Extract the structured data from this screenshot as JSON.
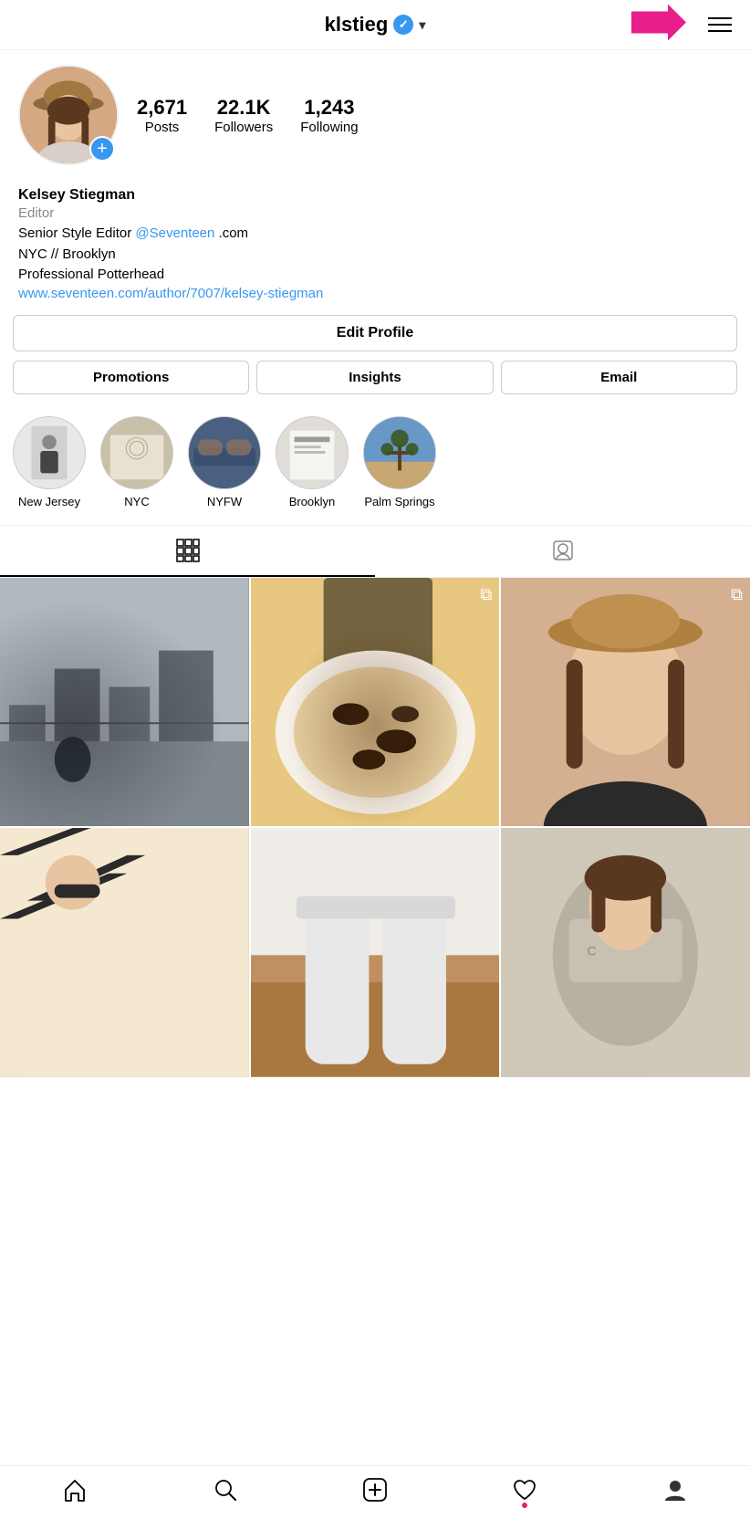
{
  "header": {
    "username": "klstieg",
    "dropdown_label": "▾",
    "hamburger_aria": "Menu"
  },
  "profile": {
    "stats": {
      "posts_count": "2,671",
      "posts_label": "Posts",
      "followers_count": "22.1K",
      "followers_label": "Followers",
      "following_count": "1,243",
      "following_label": "Following"
    },
    "bio": {
      "name": "Kelsey Stiegman",
      "title": "Editor",
      "line1_prefix": "Senior Style Editor ",
      "line1_mention": "@Seventeen",
      "line1_suffix": " .com",
      "line2": "NYC // Brooklyn",
      "line3": "Professional Potterhead",
      "link": "www.seventeen.com/author/7007/kelsey-stiegman"
    }
  },
  "buttons": {
    "edit_profile": "Edit Profile",
    "promotions": "Promotions",
    "insights": "Insights",
    "email": "Email"
  },
  "highlights": [
    {
      "label": "New Jersey",
      "style": "nj"
    },
    {
      "label": "NYC",
      "style": "nyc"
    },
    {
      "label": "NYFW",
      "style": "nyfw"
    },
    {
      "label": "Brooklyn",
      "style": "brooklyn"
    },
    {
      "label": "Palm Springs",
      "style": "ps"
    }
  ],
  "tabs": {
    "grid_tab_aria": "Posts grid view",
    "tagged_tab_aria": "Tagged posts"
  },
  "grid_items": [
    {
      "id": 1,
      "style": "gi-1",
      "has_multi": false
    },
    {
      "id": 2,
      "style": "gi-2",
      "has_multi": true
    },
    {
      "id": 3,
      "style": "gi-3",
      "has_multi": true
    },
    {
      "id": 4,
      "style": "gi-4",
      "has_multi": false
    },
    {
      "id": 5,
      "style": "gi-5",
      "has_multi": false
    },
    {
      "id": 6,
      "style": "gi-6",
      "has_multi": false
    }
  ],
  "bottom_nav": {
    "home": "Home",
    "search": "Search",
    "add": "Add",
    "heart": "Activity",
    "profile": "Profile"
  },
  "colors": {
    "verified_blue": "#3897f0",
    "arrow_pink": "#e91e8c",
    "link_blue": "#3897f0"
  }
}
